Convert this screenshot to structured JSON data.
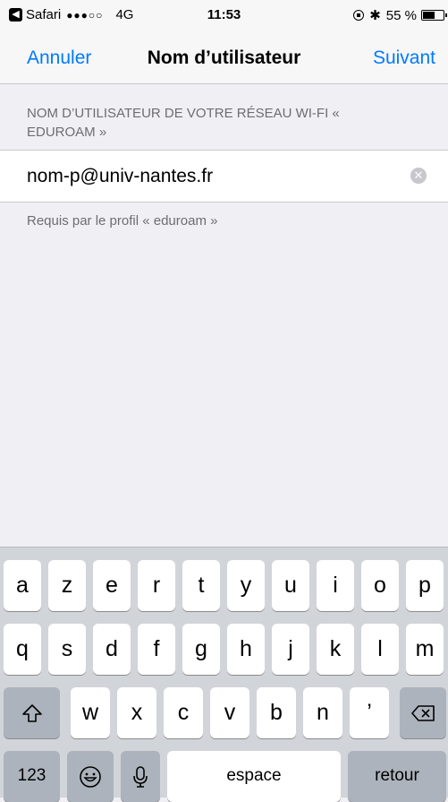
{
  "status_bar": {
    "back_app": "Safari",
    "signal": "●●●○○",
    "network": "4G",
    "time": "11:53",
    "battery": "55 %"
  },
  "nav": {
    "left_label": "Annuler",
    "title": "Nom d’utilisateur",
    "right_label": "Suivant"
  },
  "form": {
    "header": "NOM D’UTILISATEUR DE VOTRE RÉSEAU WI-FI « EDUROAM »",
    "input_value": "nom-p@univ-nantes.fr",
    "footer": "Requis par le profil « eduroam »"
  },
  "keyboard": {
    "row1": [
      "a",
      "z",
      "e",
      "r",
      "t",
      "y",
      "u",
      "i",
      "o",
      "p"
    ],
    "row2": [
      "q",
      "s",
      "d",
      "f",
      "g",
      "h",
      "j",
      "k",
      "l",
      "m"
    ],
    "row3": [
      "w",
      "x",
      "c",
      "v",
      "b",
      "n",
      "’"
    ],
    "numbers_label": "123",
    "space_label": "espace",
    "return_label": "retour"
  }
}
